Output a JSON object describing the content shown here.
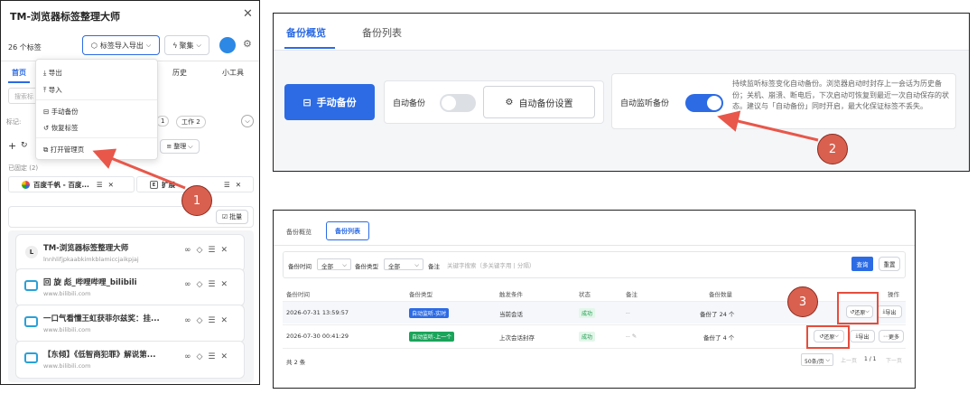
{
  "left": {
    "title": "TM-浏览器标签整理大师",
    "count": "26 个标签",
    "import_export": "标签导入导出",
    "gather": "聚集",
    "tabs": [
      "首页",
      "历史",
      "小工具"
    ],
    "search_placeholder": "搜索标",
    "tags_label": "标记:",
    "tag_chip1": "1",
    "tag_chip2": "工作 2",
    "organize": "整理",
    "pinned": "已固定 (2)",
    "pinned1": "百度千帆 - 百度...",
    "pinned2": "扩展",
    "batch": "批量",
    "menu": [
      "导出",
      "导入",
      "手动备份",
      "恢复标签",
      "打开管理页"
    ],
    "items": [
      {
        "icon": "L",
        "title": "TM-浏览器标签整理大师",
        "sub": "lnnhlifjpkaabkimkblamiccjaikpjaj"
      },
      {
        "icon": "bili",
        "title": "回 旋 彪_哔哩哔哩_bilibili",
        "sub": "www.bilibili.com"
      },
      {
        "icon": "bili",
        "title": "一口气看懂王虹获菲尔兹奖：挂...",
        "sub": "www.bilibili.com"
      },
      {
        "icon": "bili",
        "title": "【东倾】《低智商犯罪》解说第...",
        "sub": "www.bilibili.com"
      }
    ]
  },
  "top": {
    "tab1": "备份概览",
    "tab2": "备份列表",
    "manual": "手动备份",
    "auto": "自动备份",
    "auto_settings": "自动备份设置",
    "monitor": "自动监听备份",
    "desc": "持续监听标签变化自动备份。浏览器启动时封存上一会话为历史备份；关机、崩溃、断电后，下次启动可恢复到最近一次自动保存的状态。建议与「自动备份」同时开启，最大化保证标签不丢失。"
  },
  "bottom": {
    "tab1": "备份概览",
    "tab2": "备份列表",
    "time_label": "备份时间",
    "time_val": "全部",
    "type_label": "备份类型",
    "type_val": "全部",
    "note_label": "备注",
    "note_placeholder": "关键字搜索（多关键字用 | 分隔）",
    "query": "查询",
    "reset": "重置",
    "headers": [
      "备份时间",
      "备份类型",
      "触发条件",
      "状态",
      "备注",
      "备份数量",
      "操作"
    ],
    "rows": [
      {
        "time": "2026-07-31 13:59:57",
        "type": "自动监听-实时",
        "trigger": "当前会话",
        "status": "成功",
        "note": "--",
        "count": "备份了 24 个",
        "a1": "还原",
        "a2": "导出"
      },
      {
        "time": "2026-07-30 00:41:29",
        "type": "自动监听-上一个",
        "trigger": "上次会话封存",
        "status": "成功",
        "note": "--",
        "count": "备份了 4 个",
        "a1": "还原",
        "a2": "导出",
        "a3": "更多"
      }
    ],
    "total": "共 2 条",
    "page_size": "50条/页",
    "prev": "上一页",
    "page": "1 / 1",
    "next": "下一页"
  },
  "callouts": [
    "1",
    "2",
    "3"
  ],
  "colors": {
    "primary": "#2c6be4",
    "arrow": "#e8574a",
    "success": "#1a9a4b"
  }
}
